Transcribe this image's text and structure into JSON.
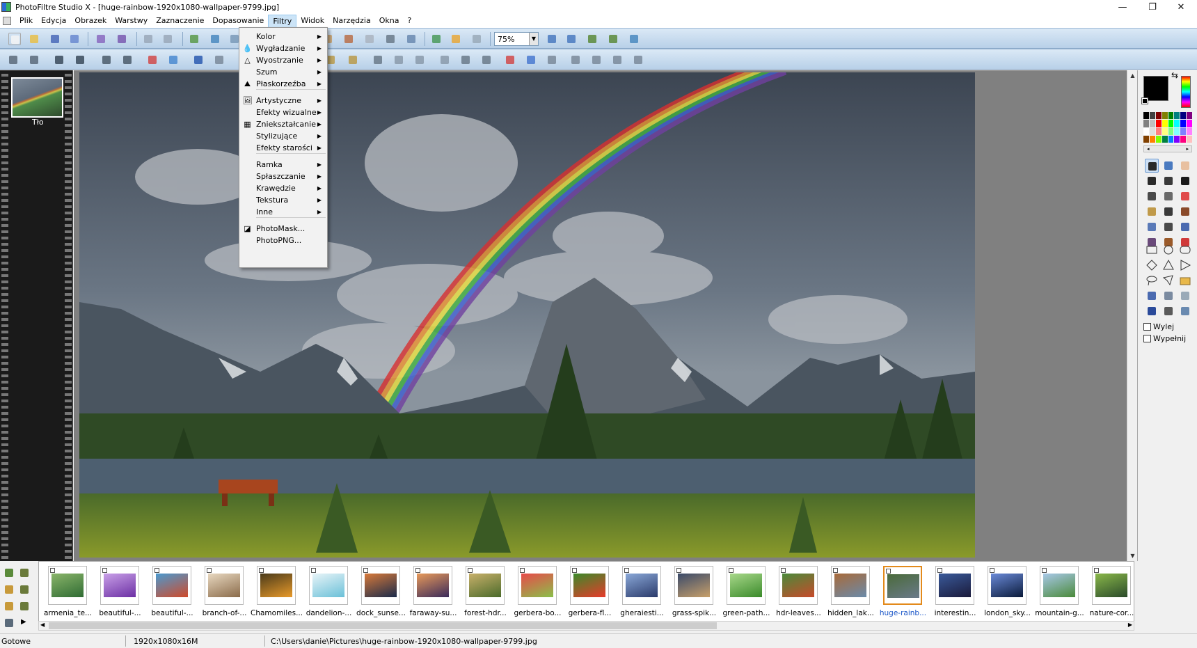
{
  "window": {
    "title": "PhotoFiltre Studio X - [huge-rainbow-1920x1080-wallpaper-9799.jpg]",
    "minimize": "—",
    "maximize": "❐",
    "close": "✕"
  },
  "menubar": {
    "items": [
      "Plik",
      "Edycja",
      "Obrazek",
      "Warstwy",
      "Zaznaczenie",
      "Dopasowanie",
      "Filtry",
      "Widok",
      "Narzędzia",
      "Okna",
      "?"
    ],
    "active": "Filtry"
  },
  "toolbar": {
    "zoom": "75%"
  },
  "filters_menu": {
    "items": [
      {
        "label": "Kolor",
        "submenu": true
      },
      {
        "label": "Wygładzanie",
        "submenu": true
      },
      {
        "label": "Wyostrzanie",
        "submenu": true
      },
      {
        "label": "Szum",
        "submenu": true
      },
      {
        "label": "Płaskorzeźba",
        "submenu": true
      },
      {
        "label": "Artystyczne",
        "submenu": true
      },
      {
        "label": "Efekty wizualne",
        "submenu": true
      },
      {
        "label": "Zniekształcanie",
        "submenu": true
      },
      {
        "label": "Stylizujące",
        "submenu": true
      },
      {
        "label": "Efekty starości",
        "submenu": true
      },
      {
        "label": "Ramka",
        "submenu": true
      },
      {
        "label": "Spłaszczanie",
        "submenu": true
      },
      {
        "label": "Krawędzie",
        "submenu": true
      },
      {
        "label": "Tekstura",
        "submenu": true
      },
      {
        "label": "Inne",
        "submenu": true
      },
      {
        "label": "PhotoMask...",
        "submenu": false
      },
      {
        "label": "PhotoPNG...",
        "submenu": false
      }
    ],
    "submenu_arrow": "▶"
  },
  "layers": {
    "label": "Tło"
  },
  "right_panel": {
    "checkbox_fill_out": "Wylej",
    "checkbox_fill": "Wypełnij",
    "palette": [
      "#000000",
      "#404040",
      "#800000",
      "#808000",
      "#008000",
      "#008080",
      "#000080",
      "#800080",
      "#808080",
      "#c0c0c0",
      "#ff0000",
      "#ffff00",
      "#00ff00",
      "#00ffff",
      "#0000ff",
      "#ff00ff",
      "#ffffff",
      "#e0e0e0",
      "#ff8080",
      "#ffff80",
      "#80ff80",
      "#80ffff",
      "#8080ff",
      "#ff80ff",
      "#804000",
      "#ff8000",
      "#80ff00",
      "#008040",
      "#0080ff",
      "#8000ff",
      "#ff0080",
      "#ffc0c0"
    ]
  },
  "filestrip": {
    "files": [
      {
        "name": "armenia_te...",
        "c1": "#2f6b33",
        "c2": "#8ab56a"
      },
      {
        "name": "beautiful-...",
        "c1": "#6b2fa3",
        "c2": "#c9a0e8"
      },
      {
        "name": "beautiful-...",
        "c1": "#d04a2a",
        "c2": "#4a9ad0"
      },
      {
        "name": "branch-of-...",
        "c1": "#8a6b4a",
        "c2": "#e8d8c0"
      },
      {
        "name": "Chamomiles...",
        "c1": "#e89a2a",
        "c2": "#4a3a1a"
      },
      {
        "name": "dandelion-...",
        "c1": "#6ac0d8",
        "c2": "#e8f4f8"
      },
      {
        "name": "dock_sunse...",
        "c1": "#1a2a4a",
        "c2": "#d87a3a"
      },
      {
        "name": "faraway-su...",
        "c1": "#3a2a5a",
        "c2": "#e89a5a"
      },
      {
        "name": "forest-hdr...",
        "c1": "#4a6a2a",
        "c2": "#c8b06a"
      },
      {
        "name": "gerbera-bo...",
        "c1": "#8ac04a",
        "c2": "#e84a4a"
      },
      {
        "name": "gerbera-fl...",
        "c1": "#e83a2a",
        "c2": "#3a8a2a"
      },
      {
        "name": "gheraiesti...",
        "c1": "#2a3a6a",
        "c2": "#8aa8d8"
      },
      {
        "name": "grass-spik...",
        "c1": "#c8a06a",
        "c2": "#3a4a6a"
      },
      {
        "name": "green-path...",
        "c1": "#3a8a2a",
        "c2": "#a8d88a"
      },
      {
        "name": "hdr-leaves...",
        "c1": "#c84a2a",
        "c2": "#4a8a3a"
      },
      {
        "name": "hidden_lak...",
        "c1": "#6a8aaa",
        "c2": "#a86a3a"
      },
      {
        "name": "huge-rainb...",
        "c1": "#6a7a8a",
        "c2": "#4a6a3a"
      },
      {
        "name": "interestin...",
        "c1": "#1a1a3a",
        "c2": "#3a5a9a"
      },
      {
        "name": "london_sky...",
        "c1": "#0a1a3a",
        "c2": "#6a8ad8"
      },
      {
        "name": "mountain-g...",
        "c1": "#4a8a3a",
        "c2": "#a8c8e8"
      },
      {
        "name": "nature-cor...",
        "c1": "#2a4a2a",
        "c2": "#8ab84a"
      }
    ],
    "selected_index": 16
  },
  "statusbar": {
    "status": "Gotowe",
    "image_info": "1920x1080x16M",
    "path": "C:\\Users\\danie\\Pictures\\huge-rainbow-1920x1080-wallpaper-9799.jpg"
  }
}
